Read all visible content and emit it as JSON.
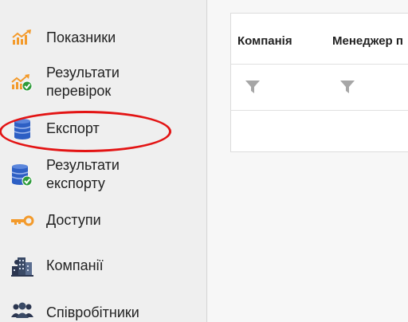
{
  "sidebar": {
    "items": [
      {
        "label": "Показники",
        "icon": "chart-trend-up-icon"
      },
      {
        "label": "Результати\nперевірок",
        "icon": "chart-trend-check-icon"
      },
      {
        "label": "Експорт",
        "icon": "database-icon"
      },
      {
        "label": "Результати\nекспорту",
        "icon": "database-check-icon"
      },
      {
        "label": "Доступи",
        "icon": "key-icon"
      },
      {
        "label": "Компанії",
        "icon": "buildings-icon"
      },
      {
        "label": "Співробітники",
        "icon": "people-icon"
      }
    ]
  },
  "table": {
    "columns": [
      "Компанія",
      "Менеджер п"
    ]
  },
  "colors": {
    "accent_orange": "#f39a2b",
    "db_blue": "#2d5fc4",
    "check_green": "#2e9b3a",
    "highlight_red": "#e31414"
  }
}
